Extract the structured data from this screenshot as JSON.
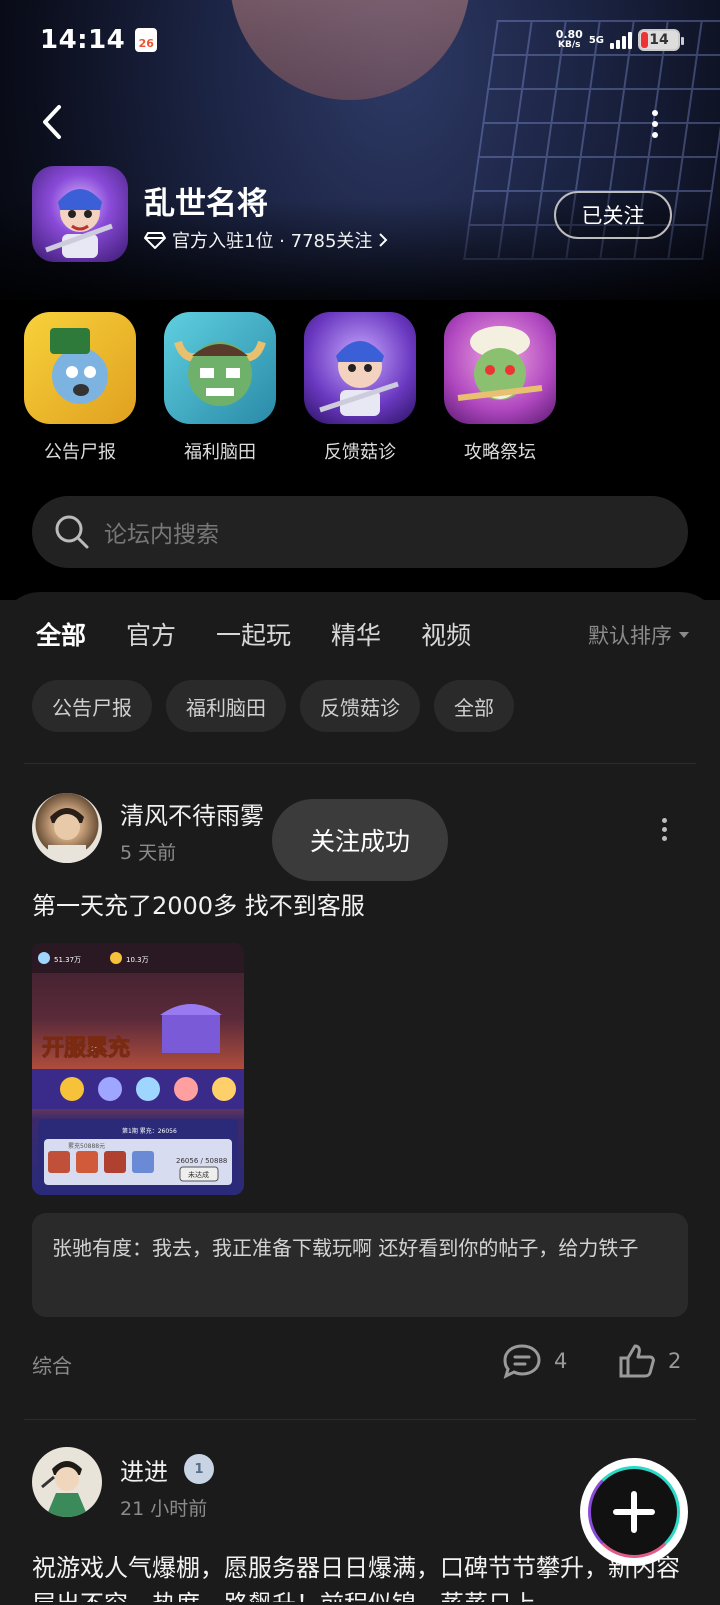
{
  "status_bar": {
    "time": "14:14",
    "calendar_day": "26",
    "speed_value": "0.80",
    "speed_unit": "KB/s",
    "network": "5G",
    "battery": "14"
  },
  "game": {
    "name": "乱世名将",
    "meta": "官方入驻1位 · 7785关注",
    "follow_label": "已关注"
  },
  "entries": [
    {
      "label": "公告尸报",
      "icon": "announcement-icon"
    },
    {
      "label": "福利脑田",
      "icon": "welfare-icon"
    },
    {
      "label": "反馈菇诊",
      "icon": "feedback-icon"
    },
    {
      "label": "攻略祭坛",
      "icon": "guide-icon"
    }
  ],
  "search": {
    "placeholder": "论坛内搜索"
  },
  "tabs": [
    "全部",
    "官方",
    "一起玩",
    "精华",
    "视频"
  ],
  "sort_label": "默认排序",
  "chips": [
    "公告尸报",
    "福利脑田",
    "反馈菇诊",
    "全部"
  ],
  "toast": "关注成功",
  "posts": [
    {
      "author": "清风不待雨雾",
      "time": "5 天前",
      "body": "第一天充了2000多 找不到客服",
      "image_text": {
        "gems": "51.37万",
        "coins": "10.3万",
        "banner": "开服累充",
        "tier": "第1期 累充：26056",
        "target": "累充50888元",
        "progress": "26056 / 50888",
        "status": "未达成"
      },
      "comment_author": "张驰有度：",
      "comment_text": "我去，我正准备下载玩啊 还好看到你的帖子，给力铁子",
      "category": "综合",
      "comments": "4",
      "likes": "2"
    },
    {
      "author": "进进",
      "time": "21 小时前",
      "badge": "1",
      "body": "祝游戏人气爆棚，愿服务器日日爆满，口碑节节攀升，新内容层出不穷，热度一路飙升！前程似锦，蒸蒸日上"
    }
  ],
  "colors": {
    "accent": "#2bd9c6",
    "background": "#1b1b1b",
    "chip": "#2a2a2a"
  }
}
